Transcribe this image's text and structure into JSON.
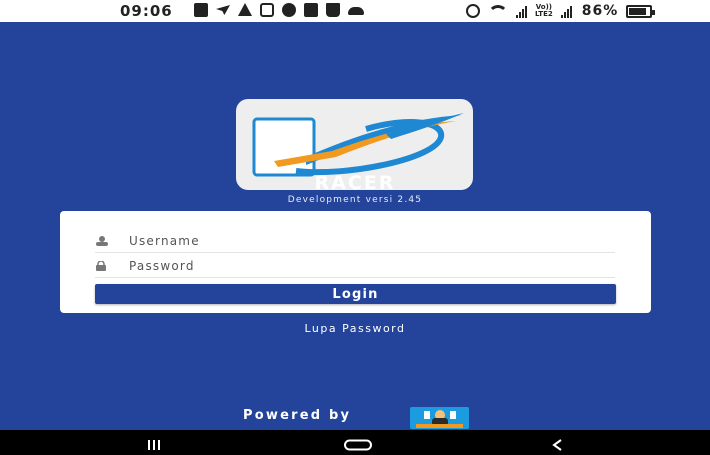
{
  "status_bar": {
    "time": "09:06",
    "battery_percent": "86%",
    "battery_level": 0.86,
    "volte": [
      "Vo))",
      "LTE2"
    ],
    "left_icons": [
      "message-icon",
      "telegram-icon",
      "alert-icon",
      "instagram-icon",
      "download-icon",
      "checkbox-icon",
      "bag-icon",
      "cloud-icon"
    ],
    "right_icons": [
      "alarm-icon",
      "wifi-icon",
      "signal-icon",
      "signal-icon",
      "battery-icon"
    ]
  },
  "app": {
    "name": "RACER",
    "version": "Development versi 2.45",
    "background_color": "#24449b",
    "logo_colors": [
      "#1e88d2",
      "#f2991f"
    ]
  },
  "login": {
    "username_placeholder": "Username",
    "password_placeholder": "Password",
    "username_value": "",
    "password_value": "",
    "login_label": "Login",
    "forgot_label": "Lupa Password"
  },
  "footer": {
    "powered_label": "Powered by"
  },
  "nav_bar": {
    "buttons": [
      "recent-apps-icon",
      "home-icon",
      "back-icon"
    ]
  }
}
